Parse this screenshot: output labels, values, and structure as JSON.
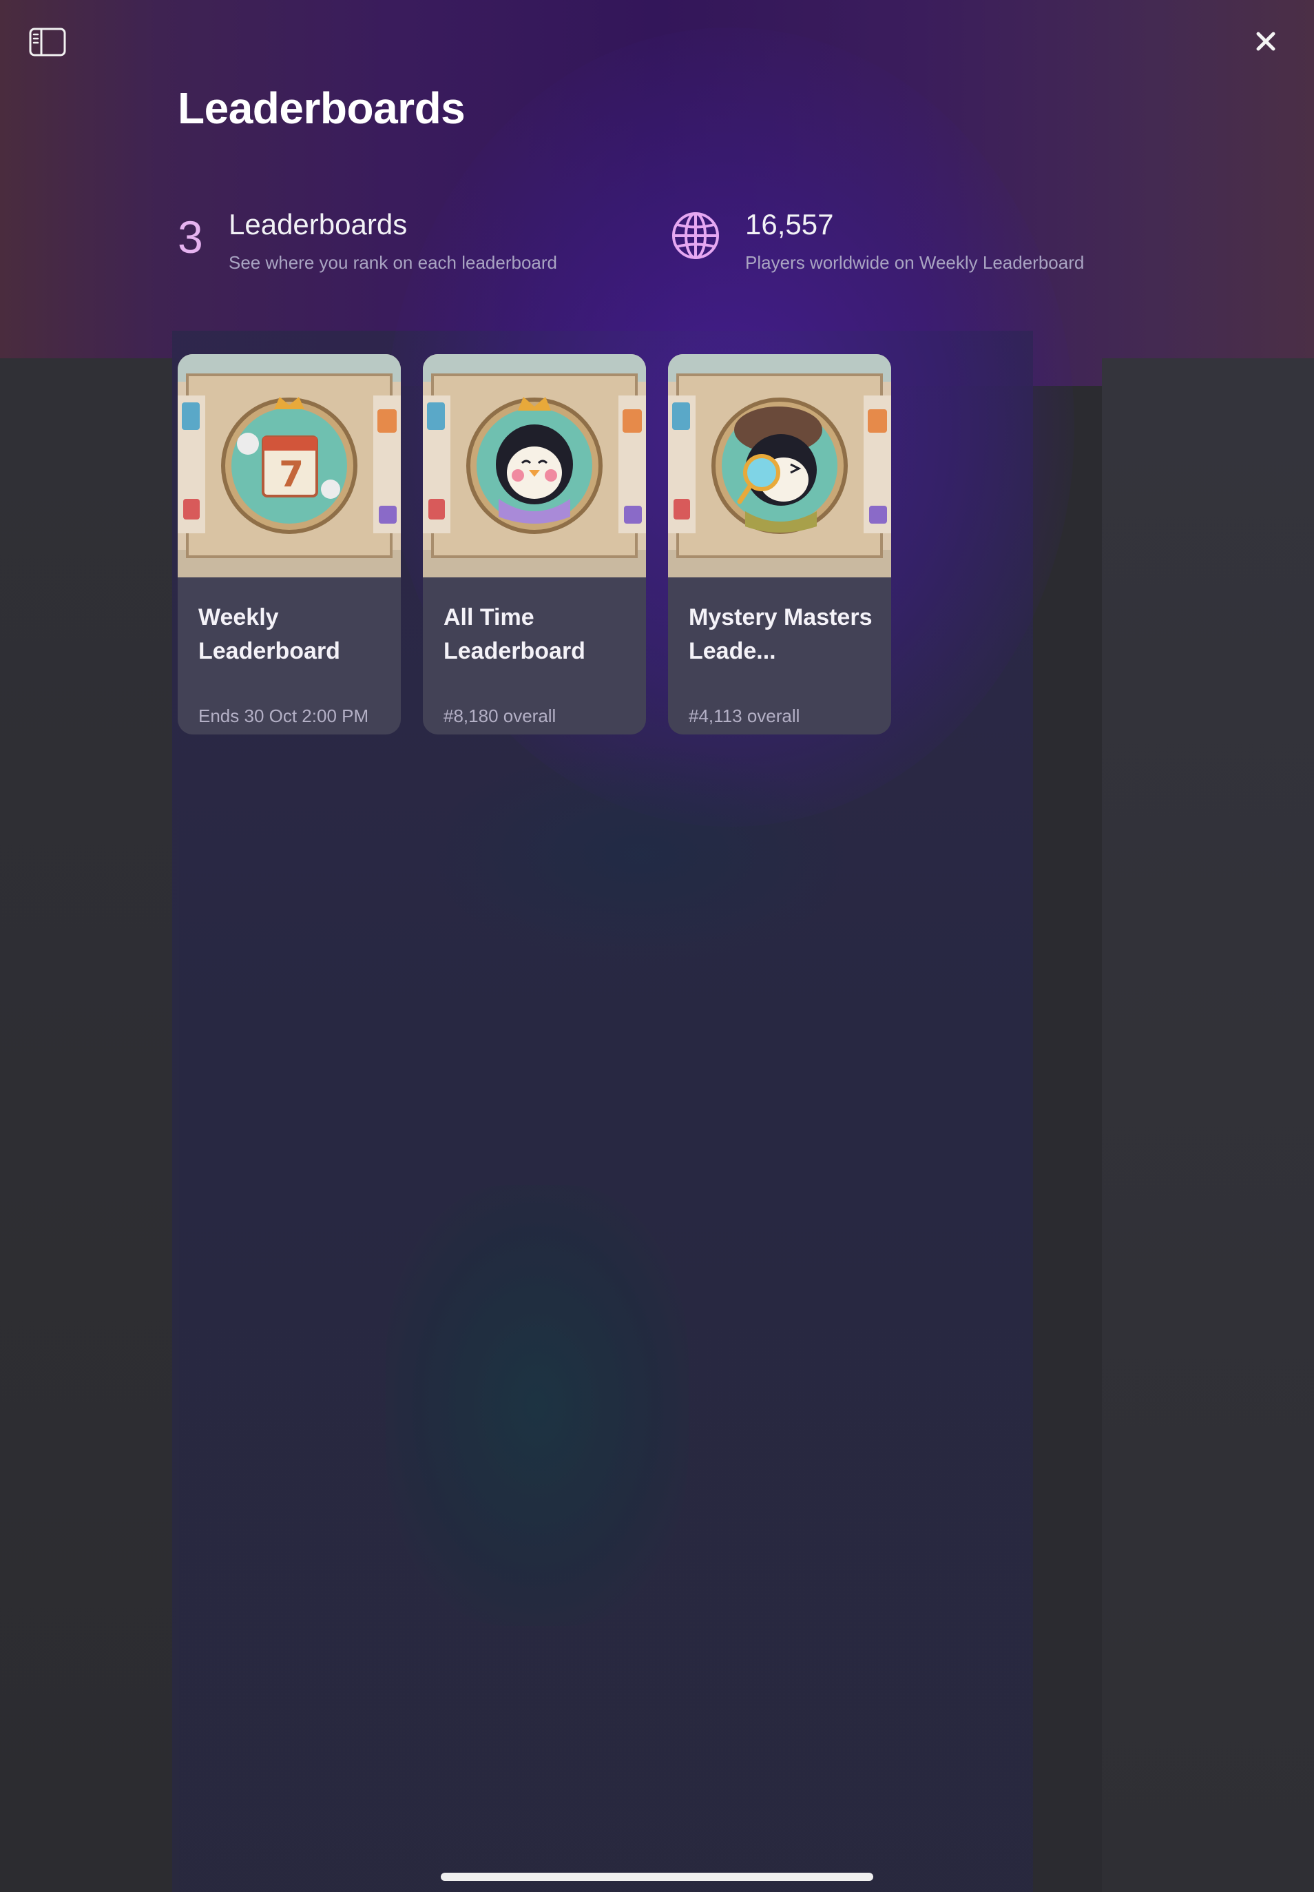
{
  "page": {
    "title": "Leaderboards"
  },
  "toolbar": {
    "sidebar_icon": "sidebar-toggle-icon",
    "close_icon": "close-icon"
  },
  "stats": {
    "leaderboards_count": "3",
    "leaderboards_label": "Leaderboards",
    "leaderboards_sub": "See where you rank on each leaderboard",
    "players_count": "16,557",
    "players_sub": "Players worldwide on Weekly Leaderboard",
    "players_icon": "globe-icon"
  },
  "cards": [
    {
      "title": "Weekly Leaderboard",
      "subtitle": "Ends 30 Oct 2:00 PM",
      "art": "calendar-badge-art"
    },
    {
      "title": "All Time Leaderboard",
      "subtitle": "#8,180 overall",
      "art": "penguin-queen-badge-art"
    },
    {
      "title": "Mystery Masters Leade...",
      "subtitle": "#4,113 overall",
      "art": "detective-penguin-badge-art"
    }
  ],
  "colors": {
    "accent": "#e6b3f0",
    "background": "#2b2b30",
    "header_purple": "#3a1c5c"
  }
}
